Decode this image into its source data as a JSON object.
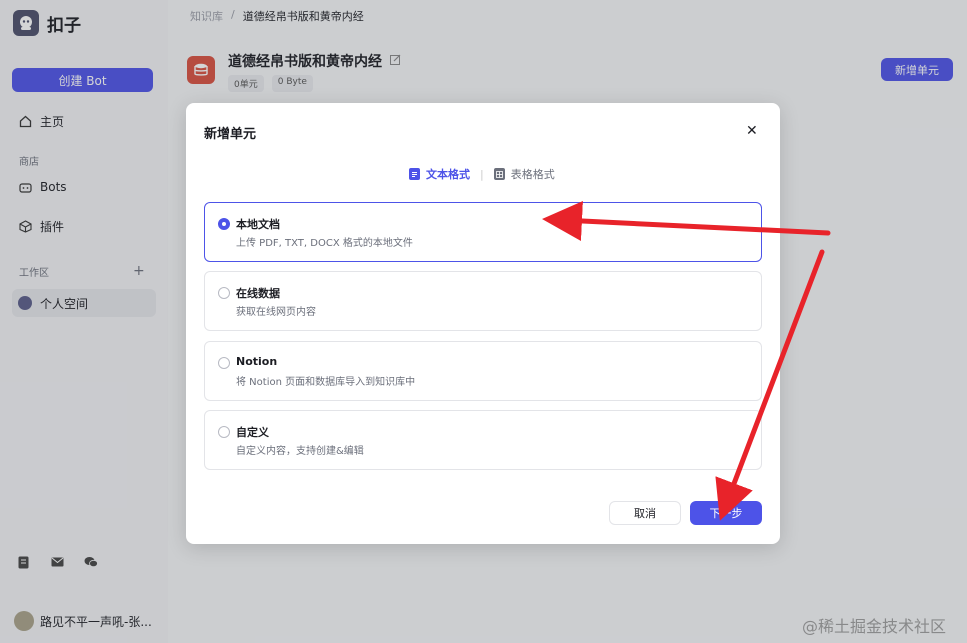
{
  "app": {
    "name": "扣子"
  },
  "sidebar": {
    "create_bot": "创建 Bot",
    "home": "主页",
    "section_shop": "商店",
    "bots": "Bots",
    "plugins": "插件",
    "section_workspace": "工作区",
    "personal_space": "个人空间",
    "user_name": "路见不平一声吼-张..."
  },
  "main": {
    "breadcrumb": [
      "知识库",
      "/",
      "道德经帛书版和黄帝内经"
    ],
    "kb_title": "道德经帛书版和黄帝内经",
    "tags": [
      "0单元",
      "0 Byte"
    ],
    "new_unit_button": "新增单元"
  },
  "modal": {
    "title": "新增单元",
    "close": "✕",
    "tabs": [
      {
        "label": "文本格式",
        "active": true
      },
      {
        "label": "表格格式",
        "active": false
      }
    ],
    "options": [
      {
        "title": "本地文档",
        "desc": "上传 PDF, TXT, DOCX 格式的本地文件",
        "selected": true
      },
      {
        "title": "在线数据",
        "desc": "获取在线网页内容",
        "selected": false
      },
      {
        "title": "Notion",
        "desc": "将 Notion 页面和数据库导入到知识库中",
        "selected": false
      },
      {
        "title": "自定义",
        "desc": "自定义内容，支持创建&编辑",
        "selected": false
      }
    ],
    "cancel": "取消",
    "next": "下一步"
  },
  "watermark": "@稀土掘金技术社区",
  "colors": {
    "accent": "#4d53e8",
    "annotation_arrow": "#e8232a",
    "kb_icon": "#d9503f"
  }
}
